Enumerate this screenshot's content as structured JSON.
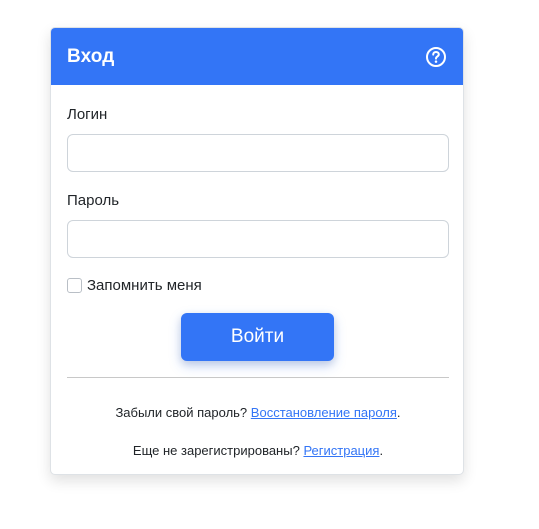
{
  "header": {
    "title": "Вход",
    "help_icon": "question-circle-icon",
    "color": "#3375f6"
  },
  "form": {
    "login_label": "Логин",
    "login_value": "",
    "password_label": "Пароль",
    "password_value": "",
    "remember_label": "Запомнить меня",
    "remember_checked": false,
    "submit_label": "Войти"
  },
  "footer": {
    "forgot_prefix": "Забыли свой пароль?",
    "forgot_link": "Восстановление пароля",
    "forgot_suffix": ".",
    "register_prefix": "Еще не зарегистрированы?",
    "register_link": "Регистрация",
    "register_suffix": "."
  }
}
